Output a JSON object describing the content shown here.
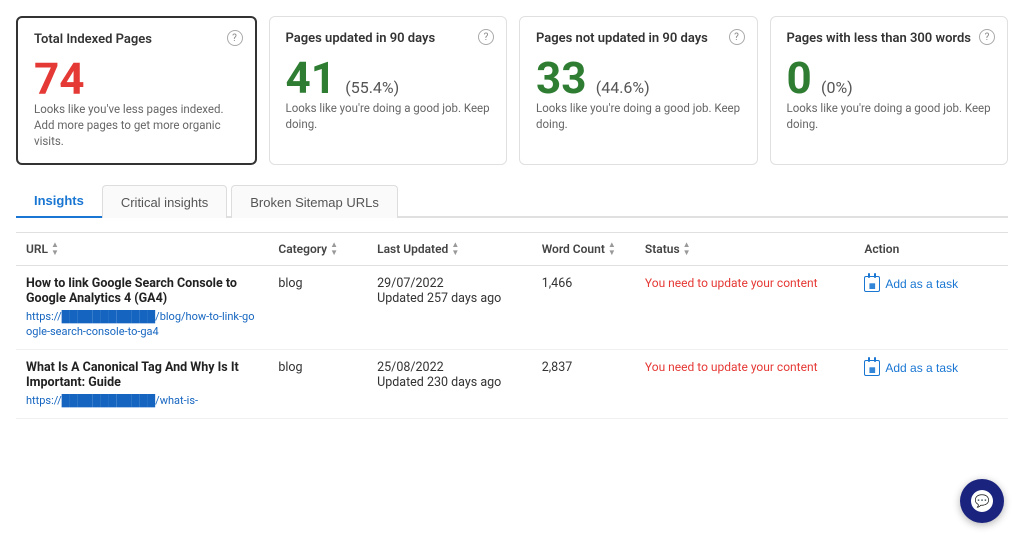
{
  "metrics": [
    {
      "id": "total-indexed",
      "title": "Total Indexed Pages",
      "value": "74",
      "valueColor": "red",
      "percent": "",
      "description": "Looks like you've less pages indexed. Add more pages to get more organic visits.",
      "highlighted": true
    },
    {
      "id": "pages-updated-90",
      "title": "Pages updated in 90 days",
      "value": "41",
      "valueColor": "green",
      "percent": "(55.4%)",
      "description": "Looks like you're doing a good job. Keep doing.",
      "highlighted": false
    },
    {
      "id": "pages-not-updated-90",
      "title": "Pages not updated in 90 days",
      "value": "33",
      "valueColor": "green",
      "percent": "(44.6%)",
      "description": "Looks like you're doing a good job. Keep doing.",
      "highlighted": false
    },
    {
      "id": "pages-less-300",
      "title": "Pages with less than 300 words",
      "value": "0",
      "valueColor": "green",
      "percent": "(0%)",
      "description": "Looks like you're doing a good job. Keep doing.",
      "highlighted": false
    }
  ],
  "tabs": [
    {
      "id": "insights",
      "label": "Insights",
      "active": true
    },
    {
      "id": "critical-insights",
      "label": "Critical insights",
      "active": false
    },
    {
      "id": "broken-sitemap",
      "label": "Broken Sitemap URLs",
      "active": false
    }
  ],
  "table": {
    "columns": [
      {
        "id": "url",
        "label": "URL"
      },
      {
        "id": "category",
        "label": "Category"
      },
      {
        "id": "last-updated",
        "label": "Last Updated"
      },
      {
        "id": "word-count",
        "label": "Word Count"
      },
      {
        "id": "status",
        "label": "Status"
      },
      {
        "id": "action",
        "label": "Action"
      }
    ],
    "rows": [
      {
        "title": "How to link Google Search Console to Google Analytics 4 (GA4)",
        "url_display": "https://████████████/blog/how-to-link-google-search-console-to-ga4",
        "url_href": "#",
        "category": "blog",
        "last_updated_date": "29/07/2022",
        "last_updated_ago": "Updated 257 days ago",
        "word_count": "1,466",
        "status": "You need to update your content",
        "action_label": "Add as a task"
      },
      {
        "title": "What Is A Canonical Tag And Why Is It Important: Guide",
        "url_display": "https://████████████/what-is-",
        "url_href": "#",
        "category": "blog",
        "last_updated_date": "25/08/2022",
        "last_updated_ago": "Updated 230 days ago",
        "word_count": "2,837",
        "status": "You need to update your content",
        "action_label": "Add as a task"
      }
    ]
  },
  "help_label": "?",
  "colors": {
    "red": "#e53935",
    "green": "#2e7d32",
    "blue": "#1976d2",
    "active_tab": "#1976d2"
  }
}
